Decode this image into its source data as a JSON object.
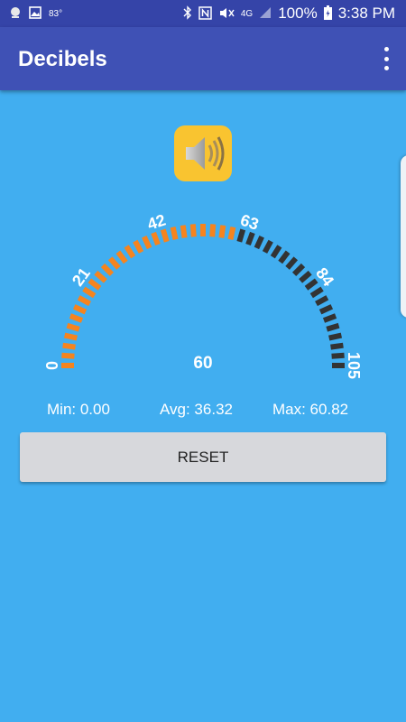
{
  "status_bar": {
    "temperature": "83°",
    "network": "4G",
    "battery": "100%",
    "time": "3:38 PM",
    "icons": [
      "status-app-icon",
      "image-icon",
      "bluetooth-icon",
      "nfc-icon",
      "mute-icon",
      "signal-icon",
      "battery-icon"
    ]
  },
  "app_bar": {
    "title": "Decibels",
    "menu_icon": "overflow-menu-icon"
  },
  "speaker": {
    "icon": "speaker-icon"
  },
  "gauge": {
    "min": 0,
    "max": 105,
    "value": 60,
    "labels": [
      "0",
      "21",
      "42",
      "63",
      "84",
      "105"
    ],
    "current_reading": "60",
    "colors": {
      "active": "#f5841f",
      "inactive": "#333333"
    }
  },
  "stats": {
    "min": "Min: 0.00",
    "avg": "Avg: 36.32",
    "max": "Max: 60.82"
  },
  "reset": {
    "label": "RESET"
  },
  "colors": {
    "background": "#41aef0",
    "app_bar": "#3f51b5",
    "status_bar": "#3544a8",
    "speaker_bg": "#f9c430"
  }
}
